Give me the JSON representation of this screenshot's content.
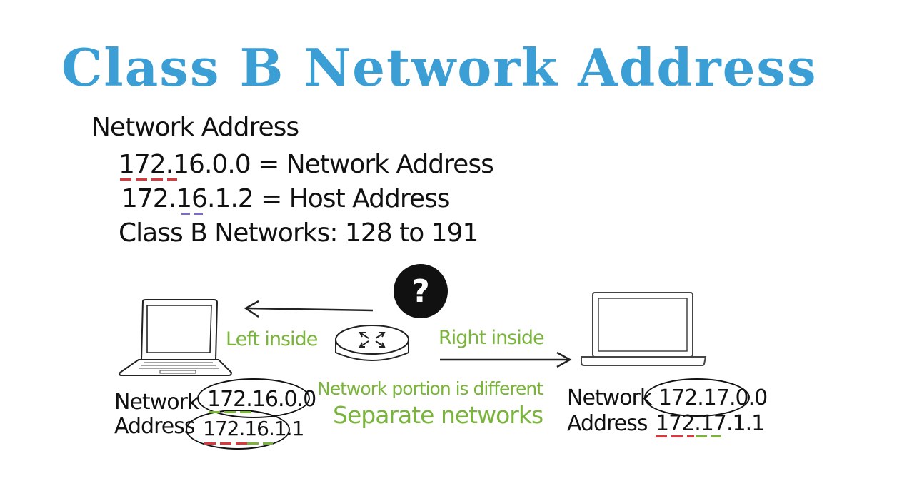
{
  "title": "Class B Network Address",
  "heading": "Network Address",
  "lines": {
    "network_example": "172.16.0.0 = Network Address",
    "host_example": "172.16.1.2 = Host Address",
    "class_range": "Class B Networks: 128 to 191"
  },
  "center": {
    "badge": "?",
    "left_label": "Left inside",
    "right_label": "Right inside",
    "note": "Network portion is different",
    "conclusion": "Separate networks"
  },
  "left_host": {
    "net_label": "Network",
    "addr_label": "Address",
    "network": "172.16.0.0",
    "host": "172.16.1.1"
  },
  "right_host": {
    "net_label": "Network",
    "addr_label": "Address",
    "network": "172.17.0.0",
    "host": "172.17.1.1"
  },
  "colors": {
    "title": "#3b9fd6",
    "annotation": "#7ab43c",
    "underline_network": "#d9393c",
    "underline_host": "#7ab43c"
  },
  "icons": [
    "laptop-icon",
    "router-icon",
    "question-icon",
    "arrow-left-icon",
    "arrow-right-icon"
  ]
}
